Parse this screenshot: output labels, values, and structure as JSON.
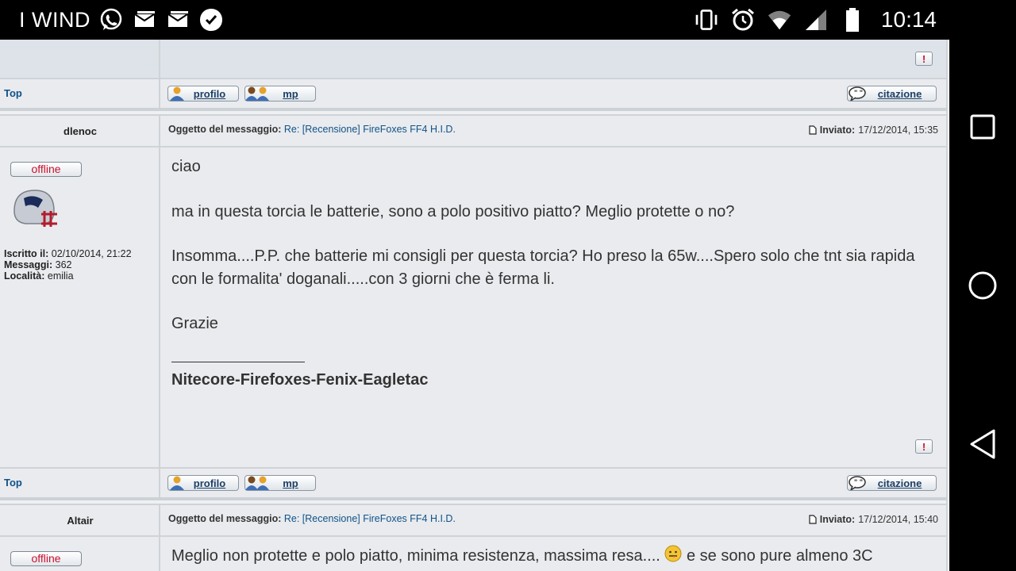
{
  "statusbar": {
    "carrier": "I WIND",
    "time": "10:14",
    "icons": [
      "whatsapp-icon",
      "mail-icon",
      "mail-icon",
      "task-check-icon",
      "vibrate-icon",
      "alarm-icon",
      "wifi-icon",
      "signal-icon",
      "battery-icon"
    ]
  },
  "navbar": {
    "buttons": [
      "recent-apps-button",
      "home-button",
      "back-button"
    ]
  },
  "forum": {
    "top_label": "Top",
    "buttons": {
      "profilo": "profilo",
      "mp": "mp",
      "citazione": "citazione"
    },
    "labels": {
      "subject": "Oggetto del messaggio:",
      "sent": "Inviato:",
      "offline": "offline"
    },
    "posts": [
      {
        "author": "dlenoc",
        "subject": "Re: [Recensione] FireFoxes FF4 H.I.D.",
        "sent": "17/12/2014, 15:35",
        "joined_label": "Iscritto il:",
        "joined": "02/10/2014, 21:22",
        "messages_label": "Messaggi:",
        "messages": "362",
        "location_label": "Località:",
        "location": "emilia",
        "body": [
          "ciao",
          "ma in questa torcia le batterie, sono a polo positivo piatto? Meglio protette o no?",
          "Insomma....P.P. che batterie mi consigli per questa torcia? Ho preso la 65w....Spero solo che tnt sia rapida con le formalita' doganali.....con 3 giorni che è ferma li.",
          "Grazie"
        ],
        "signature": "Nitecore-Firefoxes-Fenix-Eagletac"
      },
      {
        "author": "Altair",
        "subject": "Re: [Recensione] FireFoxes FF4 H.I.D.",
        "sent": "17/12/2014, 15:40",
        "body_start": "Meglio non protette e polo piatto, minima resistenza, massima resa....",
        "body_end": "e se sono pure almeno 3C"
      }
    ]
  },
  "colors": {
    "link": "#105289",
    "offline": "#c8102e",
    "report": "#c8102e"
  }
}
